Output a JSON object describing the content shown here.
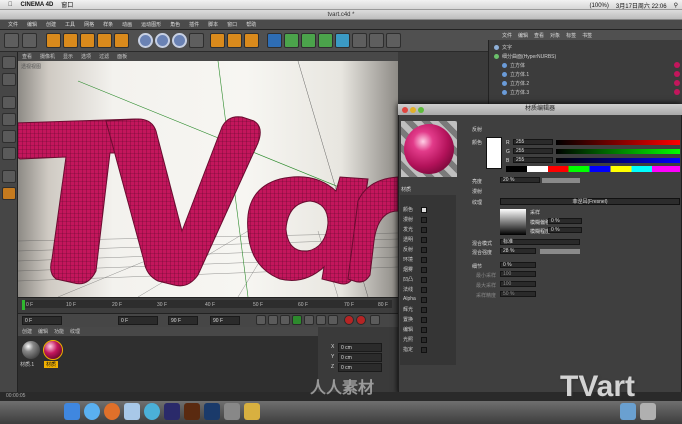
{
  "menubar": {
    "app": "CINEMA 4D",
    "items": [
      "窗口"
    ],
    "clock": "3月17日周六  22:06",
    "battery": "(100%)"
  },
  "window": {
    "title": "tvart.c4d *"
  },
  "c4d_menu": [
    "文件",
    "编辑",
    "创建",
    "工具",
    "网格",
    "样条",
    "动画",
    "运动图形",
    "角色",
    "插件",
    "脚本",
    "窗口",
    "帮助"
  ],
  "right_panel": {
    "header": [
      "文件",
      "编辑",
      "查看",
      "对象",
      "标签",
      "书签"
    ],
    "objects": [
      "文字",
      "细分曲面(HyperNURBS)",
      "立方体",
      "立方体.1",
      "立方体.2",
      "立方体.3"
    ]
  },
  "viewport": {
    "menu": [
      "查看",
      "摄像机",
      "显示",
      "选项",
      "过滤",
      "面板"
    ],
    "label": "透视视图"
  },
  "timeline": {
    "ticks": [
      "0 F",
      "10 F",
      "20 F",
      "30 F",
      "40 F",
      "50 F",
      "60 F",
      "70 F",
      "80 F",
      "90 F"
    ],
    "start": "0 F",
    "current": "0 F",
    "end": "90 F",
    "end2": "90 F"
  },
  "material_manager": {
    "menu": [
      "创建",
      "编辑",
      "功能",
      "纹理"
    ],
    "materials": [
      "材质.1",
      "材质"
    ]
  },
  "coords": {
    "labels": [
      "X",
      "Y",
      "Z"
    ],
    "values": [
      "0 cm",
      "0 cm",
      "0 cm"
    ],
    "apply": "应用"
  },
  "material_editor": {
    "title": "材质编辑器",
    "section": "颜色",
    "color_label": "颜色",
    "r": "R",
    "g": "G",
    "b": "B",
    "rv": "255",
    "gv": "255",
    "bv": "255",
    "brightness_label": "亮度",
    "brightness_value": "20 %",
    "texture_label": "纹理",
    "sample_label": "采样",
    "blur_offset_label": "模糊偏移",
    "blur_offset_value": "0 %",
    "blur_scale_label": "模糊程度",
    "blur_scale_value": "0 %",
    "fresnel_label": "菲涅耳(Fresnel)",
    "mix_mode_label": "混合模式",
    "mix_mode_value": "标准",
    "mix_strength_label": "混合强度",
    "mix_strength_value": "28 %",
    "shader_label": "细节",
    "extra1": "漫射",
    "extra1_val": "0 %",
    "extra2": "最小采样",
    "extra2_val": "100",
    "extra3": "最大采样",
    "extra3_val": "100",
    "extra4": "采样精度",
    "extra4_val": "50 %",
    "material_name": "材质",
    "channels": [
      "颜色",
      "漫射",
      "发光",
      "透明",
      "反射",
      "环境",
      "烟雾",
      "凹凸",
      "法线",
      "Alpha",
      "辉光",
      "置换",
      "编辑",
      "光照",
      "指定"
    ],
    "reflect_label": "反射"
  },
  "status": {
    "text": "00:00:05"
  },
  "watermark": {
    "text": "TVart",
    "sub": "人人素材"
  },
  "dock_apps": [
    "finder",
    "safari",
    "firefox",
    "mail",
    "itunes",
    "ae",
    "ai",
    "ps",
    "preferences",
    "photos",
    "folder",
    "trash"
  ],
  "colors": {
    "text_model": "#c3165c",
    "accent_blue": "#2e6db4"
  }
}
